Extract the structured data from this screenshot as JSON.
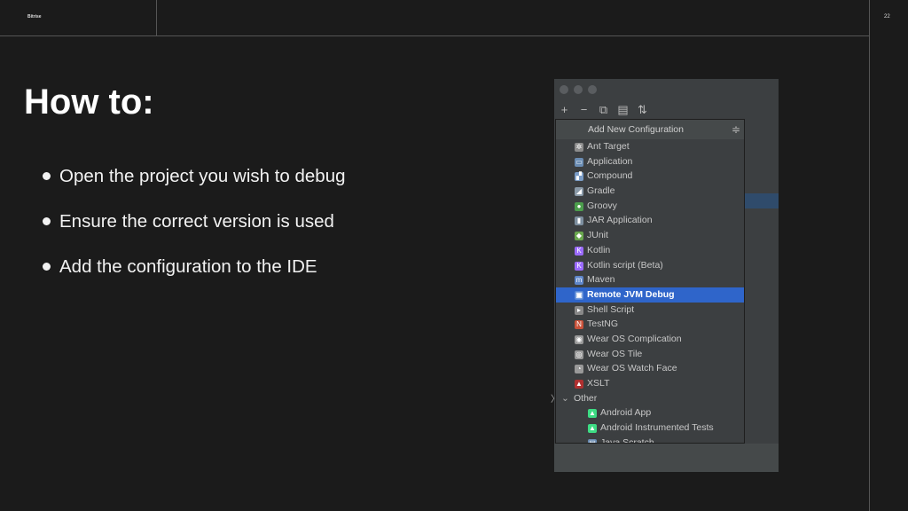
{
  "slide": {
    "brand": "Bitrise",
    "page_number": "22",
    "title": "How to:",
    "bullets": [
      "Open the project you wish to debug",
      "Ensure the correct version is used",
      "Add the configuration to the IDE"
    ]
  },
  "ide": {
    "toolbar": [
      "+",
      "−",
      "⧉",
      "▤",
      "⇅"
    ],
    "popup_title": "Add New Configuration",
    "items": [
      {
        "label": "Ant Target",
        "icon": "ant-icon",
        "color": "#8c8c8c",
        "glyph": "✲"
      },
      {
        "label": "Application",
        "icon": "application-icon",
        "color": "#6a8cb3",
        "glyph": "▭"
      },
      {
        "label": "Compound",
        "icon": "compound-icon",
        "color": "#7a9cc6",
        "glyph": "▞"
      },
      {
        "label": "Gradle",
        "icon": "gradle-icon",
        "color": "#8a9aa8",
        "glyph": "◢"
      },
      {
        "label": "Groovy",
        "icon": "groovy-icon",
        "color": "#4c9e4c",
        "glyph": "●"
      },
      {
        "label": "JAR Application",
        "icon": "jar-icon",
        "color": "#7d8f9f",
        "glyph": "▮"
      },
      {
        "label": "JUnit",
        "icon": "junit-icon",
        "color": "#6aa84f",
        "glyph": "◆"
      },
      {
        "label": "Kotlin",
        "icon": "kotlin-icon",
        "color": "#9b6bff",
        "glyph": "K"
      },
      {
        "label": "Kotlin script (Beta)",
        "icon": "kotlin-script-icon",
        "color": "#9b6bff",
        "glyph": "K"
      },
      {
        "label": "Maven",
        "icon": "maven-icon",
        "color": "#5f86c9",
        "glyph": "m"
      },
      {
        "label": "Remote JVM Debug",
        "icon": "remote-debug-icon",
        "color": "#5b8ad6",
        "glyph": "▣"
      },
      {
        "label": "Shell Script",
        "icon": "shell-script-icon",
        "color": "#888888",
        "glyph": "▸"
      },
      {
        "label": "TestNG",
        "icon": "testng-icon",
        "color": "#c9523a",
        "glyph": "N"
      },
      {
        "label": "Wear OS Complication",
        "icon": "wear-os-complication-icon",
        "color": "#999999",
        "glyph": "◉"
      },
      {
        "label": "Wear OS Tile",
        "icon": "wear-os-tile-icon",
        "color": "#999999",
        "glyph": "◎"
      },
      {
        "label": "Wear OS Watch Face",
        "icon": "wear-os-watch-face-icon",
        "color": "#999999",
        "glyph": "◔"
      },
      {
        "label": "XSLT",
        "icon": "xslt-icon",
        "color": "#b03030",
        "glyph": "▲"
      }
    ],
    "selected_item": "Remote JVM Debug",
    "group_label": "Other",
    "sub_items": [
      {
        "label": "Android App",
        "icon": "android-icon",
        "color": "#3ddc84",
        "glyph": "▲"
      },
      {
        "label": "Android Instrumented Tests",
        "icon": "android-test-icon",
        "color": "#3ddc84",
        "glyph": "▲"
      },
      {
        "label": "Java Scratch",
        "icon": "java-scratch-icon",
        "color": "#6a8cb3",
        "glyph": "▤"
      }
    ]
  }
}
